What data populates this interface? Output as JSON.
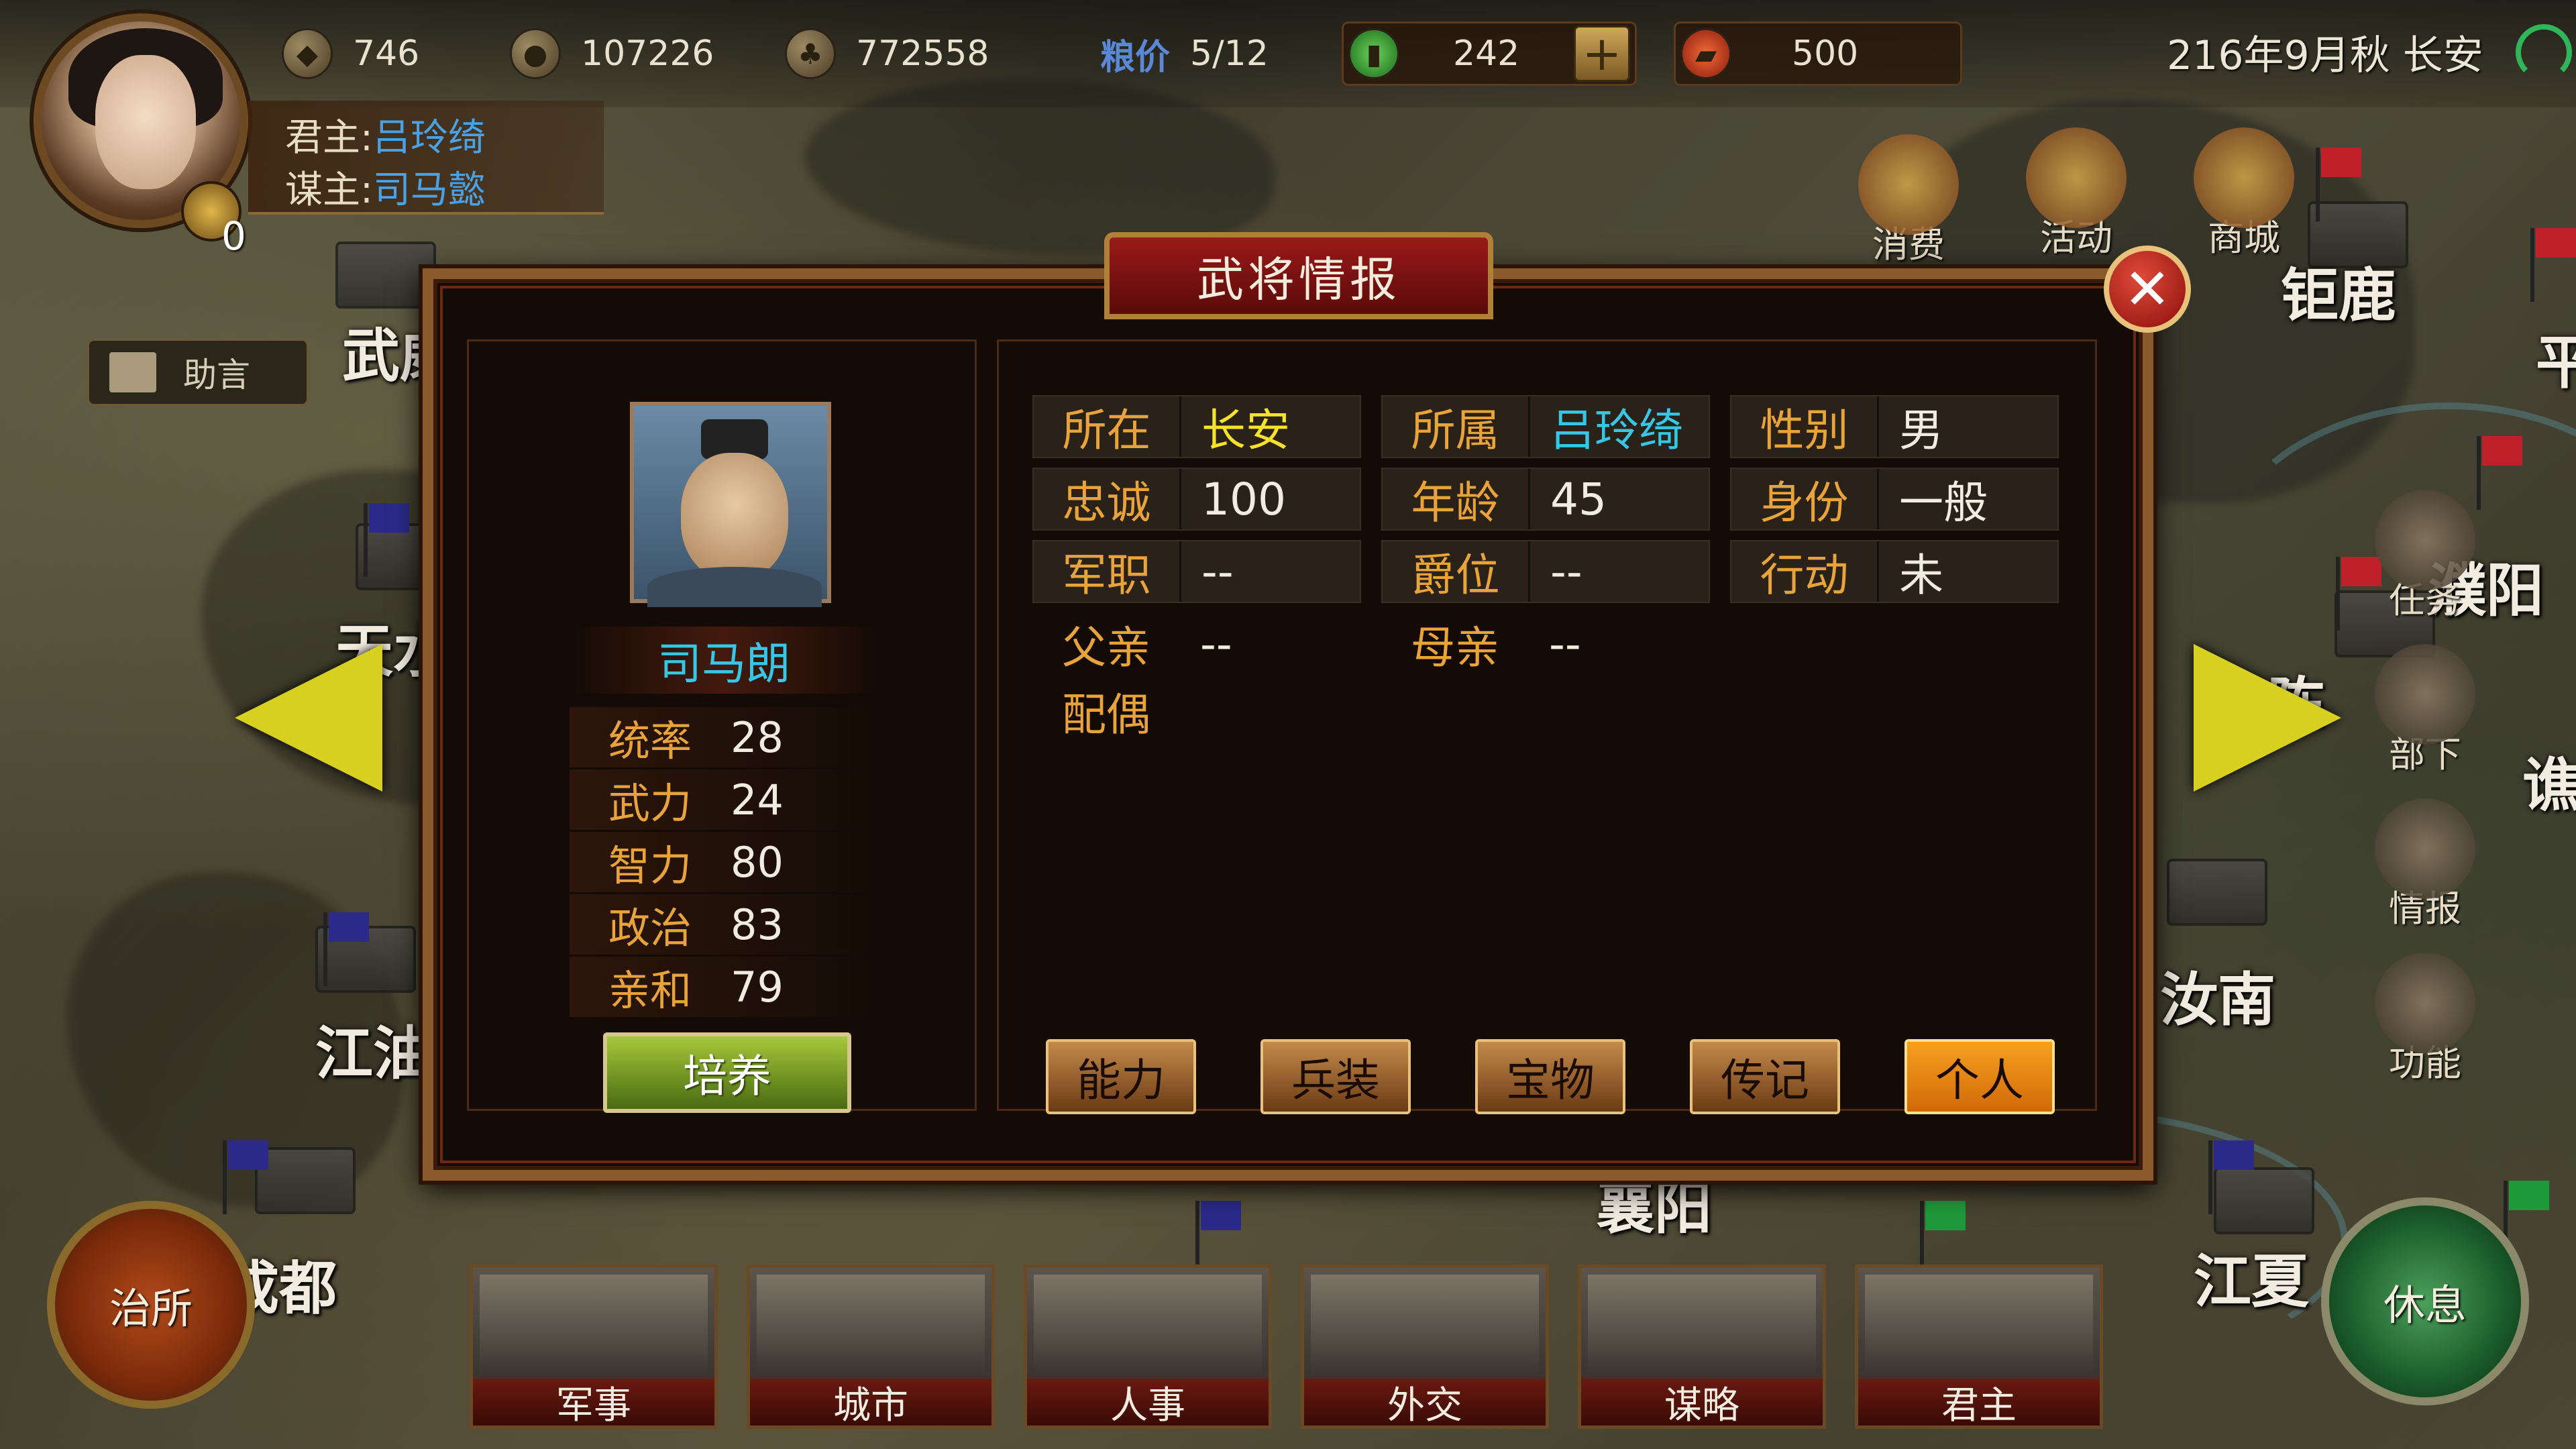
{
  "resources": {
    "copper": "746",
    "coin": "107226",
    "grain": "772558",
    "price_label": "粮价",
    "price_value": "5/12",
    "jade": "242",
    "plus": "+",
    "ticket": "500",
    "date": "216年9月秋 长安"
  },
  "lord": {
    "lord_label": "君主:",
    "lord_name": "吕玲绮",
    "advisor_label": "谋主:",
    "advisor_name": "司马懿",
    "seal_count": "0"
  },
  "advice_button": "助言",
  "top_icons": [
    "消费",
    "活动",
    "商城"
  ],
  "side_menu": [
    "任务",
    "部下",
    "情报",
    "功能"
  ],
  "map_labels": [
    "钜鹿",
    "武威",
    "天水",
    "江油",
    "成都",
    "襄阳",
    "汝南",
    "江夏",
    "濮阳",
    "陈",
    "谯",
    "平"
  ],
  "dialog": {
    "title": "武将情报",
    "close": "✕",
    "officer_name": "司马朗",
    "stats": [
      {
        "label": "统率",
        "value": "28"
      },
      {
        "label": "武力",
        "value": "24"
      },
      {
        "label": "智力",
        "value": "80"
      },
      {
        "label": "政治",
        "value": "83"
      },
      {
        "label": "亲和",
        "value": "79"
      }
    ],
    "train_button": "培养",
    "info": {
      "location_label": "所在",
      "location_value": "长安",
      "faction_label": "所属",
      "faction_value": "吕玲绮",
      "gender_label": "性别",
      "gender_value": "男",
      "loyalty_label": "忠诚",
      "loyalty_value": "100",
      "age_label": "年龄",
      "age_value": "45",
      "status_label": "身份",
      "status_value": "一般",
      "military_label": "军职",
      "military_value": "--",
      "rank_label": "爵位",
      "rank_value": "--",
      "action_label": "行动",
      "action_value": "未",
      "father_label": "父亲",
      "father_value": "--",
      "mother_label": "母亲",
      "mother_value": "--",
      "spouse_label": "配偶",
      "spouse_value": ""
    },
    "tabs": [
      "能力",
      "兵装",
      "宝物",
      "传记",
      "个人"
    ],
    "active_tab": "个人"
  },
  "bottom_menu": [
    "军事",
    "城市",
    "人事",
    "外交",
    "谋略",
    "君主"
  ],
  "office_button": "治所",
  "rest_button": "休息",
  "colors": {
    "accent_gold": "#e8a33a",
    "name_cyan": "#36c6e6",
    "value_yellow": "#f6e22a",
    "dialog_title_red": "#9a1a18",
    "active_tab_orange": "#f8a020"
  }
}
